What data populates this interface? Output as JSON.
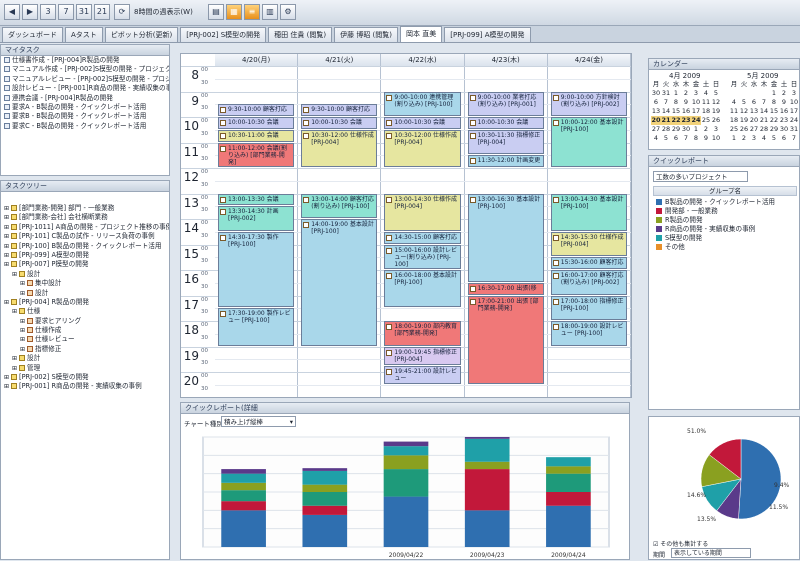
{
  "toolbar": {
    "title": "8時間の週表示(W)",
    "buttons": [
      "3",
      "7",
      "31",
      "21"
    ]
  },
  "tabs": [
    "ダッシュボード",
    "Aタスト",
    "ピボット分析(更新)",
    "[PRJ-002] S模型の開発",
    "穂田 住貴 (閲覧)",
    "伊藤 博昭 (閲覧)",
    "岡本 直美",
    "[PRJ-099] A模型の開発"
  ],
  "active_tab": 6,
  "mytask": {
    "title": "マイタスク",
    "rows": [
      "仕様書作成 - [PRJ-004]R製品の開発",
      "マニュアル作成 - [PRJ-002]S模型の開発 - プロジェクト管",
      "マニュアルレビュー - [PRJ-002]S模型の開発 - プロジェクト",
      "設計レビュー - [PRJ-001]R商品の開発 - 実績収集の事例",
      "連携会議 - [PRJ-004]R製品の開発",
      "要求A - B製品の開発 - クイックレポート活用",
      "要求B - B製品の開発 - クイックレポート活用",
      "要求C - B製品の開発 - クイックレポート活用"
    ]
  },
  "tasktree": {
    "title": "タスクツリー",
    "rows": [
      "[部門業務-開発] 部門 - 一般業務",
      "[部門業務-会社] 会社横断業務",
      "[PRJ-1011] A商品の開発 - プロジェクト推移の事例",
      "[PRJ-101] C製品の試作 - リリース負荷の事例",
      "[PRJ-100] B製品の開発 - クイックレポート活用",
      "[PRJ-099] A模型の開発",
      "[PRJ-007] P模型の開発",
      "設計",
      "集中設計",
      "設計",
      "[PRJ-004] R製品の開発",
      "仕様",
      "要求ヒアリング",
      "仕様作成",
      "仕様レビュー",
      "指標修正",
      "設計",
      "管理",
      "[PRJ-002] S模型の開発",
      "[PRJ-001] R商品の開発 - 実績収集の事例"
    ]
  },
  "calendar": {
    "days": [
      "4/20(月)",
      "4/21(火)",
      "4/22(水)",
      "4/23(木)",
      "4/24(金)"
    ],
    "hours": [
      "8",
      "9",
      "10",
      "11",
      "12",
      "13",
      "14",
      "15",
      "16",
      "17",
      "18",
      "19",
      "20"
    ],
    "minutes": [
      "00",
      "30"
    ],
    "events": [
      {
        "day": 0,
        "start": 9.5,
        "end": 10.0,
        "color": "#c9cdf2",
        "text": "9:30-10:00 顧客打応"
      },
      {
        "day": 0,
        "start": 10.0,
        "end": 10.5,
        "color": "#c9cdf2",
        "text": "10:00-10:30 会議"
      },
      {
        "day": 0,
        "start": 10.5,
        "end": 11.0,
        "color": "#e6e6a0",
        "text": "10:30-11:00 会議"
      },
      {
        "day": 0,
        "start": 11.0,
        "end": 12.0,
        "color": "#f07878",
        "text": "11:00-12:00 会議(割り込み) [部門業務-開発]"
      },
      {
        "day": 0,
        "start": 13.0,
        "end": 13.5,
        "color": "#8de2d2",
        "text": "13:00-13:30 会議"
      },
      {
        "day": 0,
        "start": 13.5,
        "end": 14.5,
        "color": "#8de2d2",
        "text": "13:30-14:30 計画 [PRJ-002]"
      },
      {
        "day": 0,
        "start": 14.5,
        "end": 17.5,
        "color": "#a9d7ea",
        "text": "14:30-17:30 製作 [PRJ-100]"
      },
      {
        "day": 0,
        "start": 17.5,
        "end": 19.0,
        "color": "#a9d7ea",
        "text": "17:30-19:00 製作レビュー [PRJ-100]"
      },
      {
        "day": 1,
        "start": 9.5,
        "end": 10.0,
        "color": "#c9cdf2",
        "text": "9:30-10:00 顧客打応"
      },
      {
        "day": 1,
        "start": 10.0,
        "end": 10.5,
        "color": "#c9cdf2",
        "text": "10:00-10:30 会議"
      },
      {
        "day": 1,
        "start": 10.5,
        "end": 12.0,
        "color": "#e6e6a0",
        "text": "10:30-12:00 仕様作成 [PRJ-004]"
      },
      {
        "day": 1,
        "start": 13.0,
        "end": 14.0,
        "color": "#8de2d2",
        "text": "13:00-14:00 顧客打応(割り込み) [PRJ-100]"
      },
      {
        "day": 1,
        "start": 14.0,
        "end": 19.0,
        "color": "#a9d7ea",
        "text": "14:00-19:00 基本設計 [PRJ-100]"
      },
      {
        "day": 2,
        "start": 9.0,
        "end": 10.0,
        "color": "#a9d7ea",
        "text": "9:00-10:00 連携管理(割り込み) [PRJ-100]"
      },
      {
        "day": 2,
        "start": 10.0,
        "end": 10.5,
        "color": "#c9cdf2",
        "text": "10:00-10:30 会議"
      },
      {
        "day": 2,
        "start": 10.5,
        "end": 12.0,
        "color": "#e6e6a0",
        "text": "10:30-12:00 仕様作成 [PRJ-004]"
      },
      {
        "day": 2,
        "start": 13.0,
        "end": 14.5,
        "color": "#e6e6a0",
        "text": "13:00-14:30 仕様作成 [PRJ-004]"
      },
      {
        "day": 2,
        "start": 14.5,
        "end": 15.0,
        "color": "#a9d7ea",
        "text": "14:30-15:00 顧客打応"
      },
      {
        "day": 2,
        "start": 15.0,
        "end": 16.0,
        "color": "#a9d7ea",
        "text": "15:00-16:00 設計レビュー(割り込み) [PRJ-100]"
      },
      {
        "day": 2,
        "start": 16.0,
        "end": 17.5,
        "color": "#a9d7ea",
        "text": "16:00-18:00 基本設計 [PRJ-100]"
      },
      {
        "day": 2,
        "start": 18.0,
        "end": 19.0,
        "color": "#f07878",
        "text": "18:00-19:00 部内教育 [部門業務-開発]"
      },
      {
        "day": 2,
        "start": 19.0,
        "end": 19.75,
        "color": "#d8c9f0",
        "text": "19:00-19:45 指標修正 [PRJ-004]"
      },
      {
        "day": 2,
        "start": 19.75,
        "end": 20.5,
        "color": "#c9cdf2",
        "text": "19:45-21:00 設計レビュー"
      },
      {
        "day": 3,
        "start": 9.0,
        "end": 10.0,
        "color": "#c9cdf2",
        "text": "9:00-10:00 業者打応(割り込み) [PRJ-001]"
      },
      {
        "day": 3,
        "start": 10.0,
        "end": 10.5,
        "color": "#c9cdf2",
        "text": "10:00-10:30 会議"
      },
      {
        "day": 3,
        "start": 10.5,
        "end": 11.5,
        "color": "#c9cdf2",
        "text": "10:30-11:30 指標修正 [PRJ-004]"
      },
      {
        "day": 3,
        "start": 11.5,
        "end": 12.0,
        "color": "#a9d7ea",
        "text": "11:30-12:00 計画変更"
      },
      {
        "day": 3,
        "start": 13.0,
        "end": 16.5,
        "color": "#a9d7ea",
        "text": "13:00-16:30 基本設計 [PRJ-100]"
      },
      {
        "day": 3,
        "start": 16.5,
        "end": 17.0,
        "color": "#f07878",
        "text": "16:30-17:00 出張(移"
      },
      {
        "day": 3,
        "start": 17.0,
        "end": 20.5,
        "color": "#f07878",
        "text": "17:00-21:00 出張 [部門業務-開発]"
      },
      {
        "day": 4,
        "start": 9.0,
        "end": 10.0,
        "color": "#c9cdf2",
        "text": "9:00-10:00 方針検討(割り込み) [PRJ-002]"
      },
      {
        "day": 4,
        "start": 10.0,
        "end": 12.0,
        "color": "#8de2d2",
        "text": "10:00-12:00 基本設計 [PRJ-100]"
      },
      {
        "day": 4,
        "start": 13.0,
        "end": 14.5,
        "color": "#8de2d2",
        "text": "13:00-14:30 基本設計 [PRJ-100]"
      },
      {
        "day": 4,
        "start": 14.5,
        "end": 15.5,
        "color": "#e6e6a0",
        "text": "14:30-15:30 仕様作成 [PRJ-004]"
      },
      {
        "day": 4,
        "start": 15.5,
        "end": 16.0,
        "color": "#a9d7ea",
        "text": "15:30-16:00 顧客打応"
      },
      {
        "day": 4,
        "start": 16.0,
        "end": 17.0,
        "color": "#a9d7ea",
        "text": "16:00-17:00 顧客打応(割り込み) [PRJ-002]"
      },
      {
        "day": 4,
        "start": 17.0,
        "end": 18.0,
        "color": "#a9d7ea",
        "text": "17:00-18:00 指標修正 [PRJ-100]"
      },
      {
        "day": 4,
        "start": 18.0,
        "end": 19.0,
        "color": "#a9d7ea",
        "text": "18:00-19:00 設計レビュー [PRJ-100]"
      }
    ]
  },
  "quick_report": {
    "title": "クイックレポート(詳細",
    "chart_type_label": "チャート種別",
    "chart_type_value": "積み上げ縦棒"
  },
  "chart_data": {
    "type": "bar",
    "stacked": true,
    "categories": [
      "",
      "",
      "2009/04/22",
      "2009/04/23",
      "2009/04/24"
    ],
    "series": [
      {
        "values": [
          4.0,
          3.5,
          5.5,
          4.0,
          4.5
        ],
        "color": "#2f6fb0"
      },
      {
        "values": [
          1.0,
          1.0,
          0,
          4.5,
          1.5
        ],
        "color": "#c2183a"
      },
      {
        "values": [
          1.2,
          1.5,
          3.0,
          0,
          2.0
        ],
        "color": "#1e9a7a"
      },
      {
        "values": [
          0.8,
          0.8,
          1.5,
          0.8,
          0.8
        ],
        "color": "#8aa020"
      },
      {
        "values": [
          1.0,
          1.5,
          1.0,
          2.5,
          1.0
        ],
        "color": "#1fa0a8"
      },
      {
        "values": [
          0.5,
          0.3,
          0.5,
          0.2,
          0
        ],
        "color": "#5a3a8a"
      }
    ],
    "ylim": [
      0,
      12
    ]
  },
  "minical": {
    "title": "カレンダー",
    "month1": "4月 2009",
    "month2": "5月 2009",
    "weekdays": [
      "月",
      "火",
      "水",
      "木",
      "金",
      "土",
      "日"
    ],
    "april": [
      [
        "30",
        "31",
        "1",
        "2",
        "3",
        "4",
        "5"
      ],
      [
        "6",
        "7",
        "8",
        "9",
        "10",
        "11",
        "12"
      ],
      [
        "13",
        "14",
        "15",
        "16",
        "17",
        "18",
        "19"
      ],
      [
        "20",
        "21",
        "22",
        "23",
        "24",
        "25",
        "26"
      ],
      [
        "27",
        "28",
        "29",
        "30",
        "1",
        "2",
        "3"
      ],
      [
        "4",
        "5",
        "6",
        "7",
        "8",
        "9",
        "10"
      ]
    ],
    "may": [
      [
        "",
        "",
        "",
        "",
        "1",
        "2",
        "3"
      ],
      [
        "4",
        "5",
        "6",
        "7",
        "8",
        "9",
        "10"
      ],
      [
        "11",
        "12",
        "13",
        "14",
        "15",
        "16",
        "17"
      ],
      [
        "18",
        "19",
        "20",
        "21",
        "22",
        "23",
        "24"
      ],
      [
        "25",
        "26",
        "27",
        "28",
        "29",
        "30",
        "31"
      ],
      [
        "1",
        "2",
        "3",
        "4",
        "5",
        "6",
        "7"
      ]
    ]
  },
  "groups": {
    "title": "クイックレポート",
    "subtitle": "工数の多いプロジェクト",
    "header": "グループ名",
    "items": [
      {
        "label": "B製品の開発 - クイックレポート活用",
        "color": "#2f6fb0"
      },
      {
        "label": "開発部 - 一般業務",
        "color": "#c2183a"
      },
      {
        "label": "R製品の開発",
        "color": "#8aa020"
      },
      {
        "label": "R商品の開発 - 実績収集の事例",
        "color": "#5a3a8a"
      },
      {
        "label": "S模型の開発",
        "color": "#1fa0a8"
      },
      {
        "label": "その他",
        "color": "#e8902a"
      }
    ]
  },
  "pie": {
    "labels": [
      "51.0%",
      "9.4%",
      "11.5%",
      "13.5%",
      "14.6%"
    ],
    "values": [
      51.0,
      9.4,
      11.5,
      13.5,
      14.6
    ],
    "colors": [
      "#2f6fb0",
      "#5a3a8a",
      "#1fa0a8",
      "#8aa020",
      "#c2183a"
    ],
    "checkbox_label": "その他も集計する",
    "footer_label": "期間",
    "footer_value": "表示している期間"
  }
}
